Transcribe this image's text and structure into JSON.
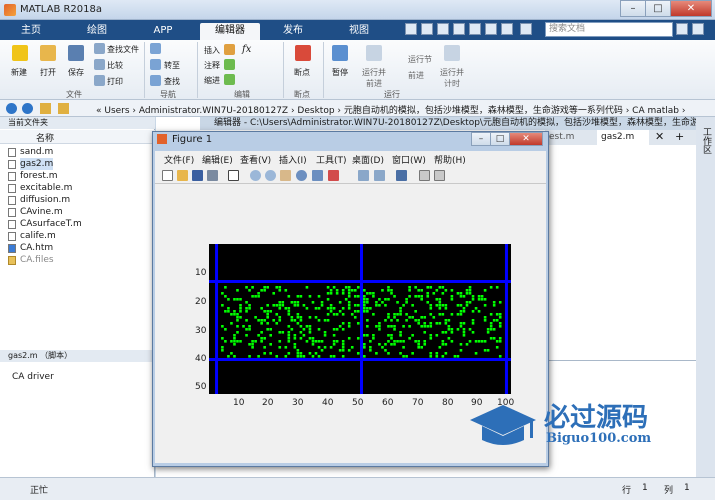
{
  "app": {
    "title": "MATLAB R2018a"
  },
  "window_controls": [
    "–",
    "□",
    "✕"
  ],
  "ribbon_tabs": [
    {
      "label": "主页",
      "x": 0
    },
    {
      "label": "绘图"
    },
    {
      "label": "APP"
    },
    {
      "label": "编辑器"
    },
    {
      "label": "发布"
    },
    {
      "label": "视图"
    }
  ],
  "search": {
    "placeholder": "搜索文档"
  },
  "ribbon": {
    "new": "新建",
    "open": "打开",
    "save": "保存",
    "find_files": "查找文件",
    "compare": "比较",
    "print": "打印",
    "goto": "转至",
    "find": "查找",
    "insert": "插入",
    "comment": "注释",
    "indent": "缩进",
    "fx": "fx",
    "breakpoints": "断点",
    "pause": "暂停",
    "run_advance": "运行并\n前进",
    "run_section": "运行节",
    "advance": "前进",
    "run_time": "运行并\n计时",
    "sections": [
      "文件",
      "导航",
      "编辑",
      "断点",
      "运行"
    ]
  },
  "address": {
    "path": "«  Users  ›  Administrator.WIN7U-20180127Z  ›  Desktop  ›  元胞自动机的模拟，包括沙堆模型，森林模型，生命游戏等一系列代码  ›  CA matlab  ›"
  },
  "current_folder": {
    "header": "当前文件夹",
    "column": "名称",
    "files": [
      "sand.m",
      "gas2.m",
      "forest.m",
      "excitable.m",
      "diffusion.m",
      "CAvine.m",
      "CAsurfaceT.m",
      "calife.m",
      "CA.htm",
      "CA.files"
    ],
    "selected": "gas2.m"
  },
  "details": {
    "title": "gas2.m （脚本）",
    "text": "CA driver"
  },
  "editor": {
    "title": "编辑器 - C:\\Users\\Administrator.WIN7U-20180127Z\\Desktop\\元胞自动机的模拟，包括沙堆模型，森林模型，生命游...",
    "tabs": [
      "est.m",
      "gas2.m"
    ],
    "right_panel": "工作区"
  },
  "figure": {
    "title": "Figure 1",
    "menu": [
      "文件(F)",
      "编辑(E)",
      "查看(V)",
      "插入(I)",
      "工具(T)",
      "桌面(D)",
      "窗口(W)",
      "帮助(H)"
    ]
  },
  "chart_data": {
    "type": "heatmap",
    "xlim": [
      0,
      100
    ],
    "ylim": [
      0,
      50
    ],
    "xticks": [
      10,
      20,
      30,
      40,
      50,
      60,
      70,
      80,
      90,
      100
    ],
    "yticks": [
      10,
      20,
      30,
      40,
      50
    ],
    "background": "#000000",
    "particle_color": "#00ff00",
    "wall_color": "#0000ff",
    "walls": {
      "horizontal_y": [
        12,
        38
      ],
      "vertical_x": [
        2,
        50,
        98
      ]
    },
    "particle_region": {
      "x": [
        4,
        96
      ],
      "y": [
        14,
        37
      ]
    }
  },
  "status": {
    "text": "正忙",
    "row_label": "行",
    "row": "1",
    "col_label": "列",
    "col": "1"
  },
  "watermark": {
    "main": "必过源码",
    "sub": "Biguo100.com"
  },
  "colors": {
    "accent": "#1f4e86",
    "tab_bg": "#f4f6f9"
  }
}
